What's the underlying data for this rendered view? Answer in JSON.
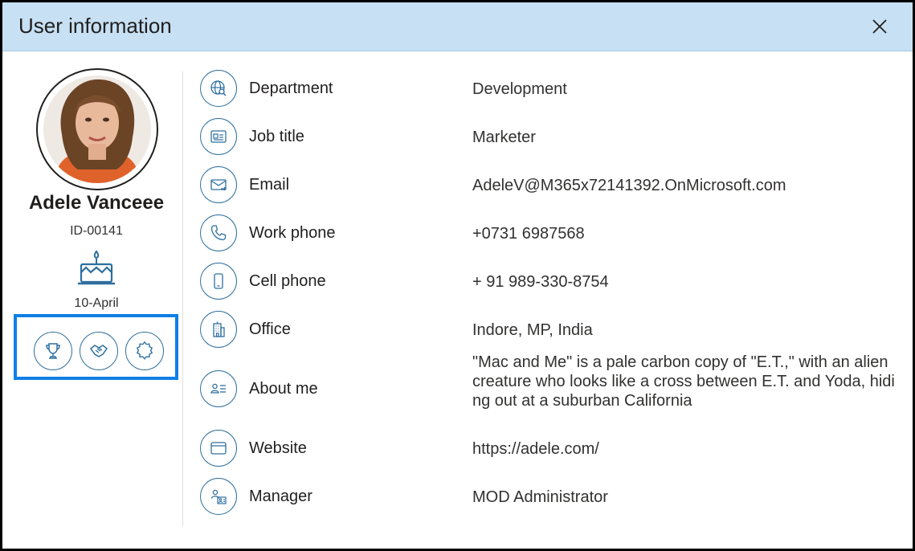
{
  "dialog": {
    "title": "User information",
    "close_icon": "close-icon"
  },
  "profile": {
    "name": "Adele Vanceee",
    "id": "ID-00141",
    "birthday_icon": "cake-icon",
    "birthday": "10-April",
    "badges": [
      {
        "icon": "trophy-icon"
      },
      {
        "icon": "handshake-icon"
      },
      {
        "icon": "award-icon"
      }
    ]
  },
  "fields": [
    {
      "label": "Department",
      "value": "Development",
      "icon": "globe-search-icon"
    },
    {
      "label": "Job title",
      "value": "Marketer",
      "icon": "id-card-icon"
    },
    {
      "label": "Email",
      "value": "AdeleV@M365x72141392.OnMicrosoft.com",
      "icon": "mail-icon"
    },
    {
      "label": "Work phone",
      "value": "+0731 6987568",
      "icon": "phone-icon"
    },
    {
      "label": "Cell phone",
      "value": "+ 91 989-330-8754",
      "icon": "mobile-icon"
    },
    {
      "label": "Office",
      "value": "Indore, MP, India",
      "icon": "building-icon"
    },
    {
      "label": "About me",
      "value": "\"Mac and Me\" is a pale carbon copy of \"E.T.,\" with an alien creature who looks like a cross between E.T. and Yoda, hiding out at a suburban California",
      "icon": "contact-list-icon"
    },
    {
      "label": "Website",
      "value": "https://adele.com/",
      "icon": "browser-icon"
    },
    {
      "label": "Manager",
      "value": "MOD Administrator",
      "icon": "manager-icon"
    }
  ],
  "colors": {
    "header_bg": "#c7e0f4",
    "icon_stroke": "#2e6f9e",
    "highlight_border": "#0f7fe6"
  }
}
